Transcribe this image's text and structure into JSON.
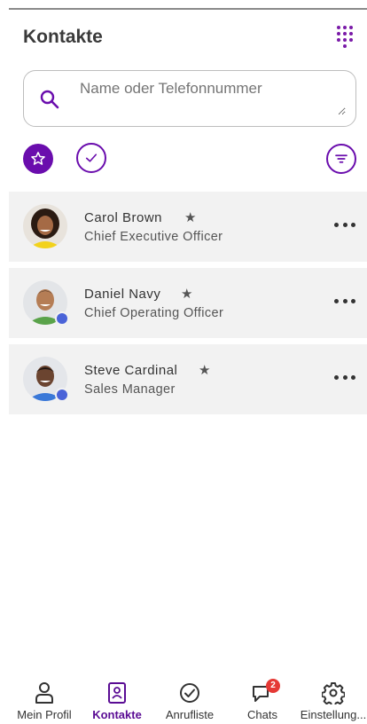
{
  "header": {
    "title": "Kontakte",
    "dialpad_icon": "dialpad-icon"
  },
  "search": {
    "placeholder": "Name oder Telefonnummer",
    "icon": "search-icon"
  },
  "filters": {
    "favorites_icon": "star-icon",
    "check_icon": "check-circle-icon",
    "filter_icon": "filter-icon"
  },
  "contacts": [
    {
      "name": "Carol Brown",
      "role": "Chief Executive Officer",
      "favorite": true,
      "online": false
    },
    {
      "name": "Daniel Navy",
      "role": "Chief Operating Officer",
      "favorite": true,
      "online": true
    },
    {
      "name": "Steve Cardinal",
      "role": "Sales Manager",
      "favorite": true,
      "online": true
    }
  ],
  "nav": [
    {
      "label": "Mein Profil",
      "icon": "person-icon",
      "active": false
    },
    {
      "label": "Kontakte",
      "icon": "contacts-icon",
      "active": true
    },
    {
      "label": "Anrufliste",
      "icon": "call-history-icon",
      "active": false
    },
    {
      "label": "Chats",
      "icon": "chat-icon",
      "active": false,
      "badge": "2"
    },
    {
      "label": "Einstellung...",
      "icon": "gear-icon",
      "active": false
    }
  ],
  "colors": {
    "accent": "#6a0dad",
    "row_bg": "#f2f2f2",
    "status": "#4a63d8",
    "badge": "#e53935"
  }
}
